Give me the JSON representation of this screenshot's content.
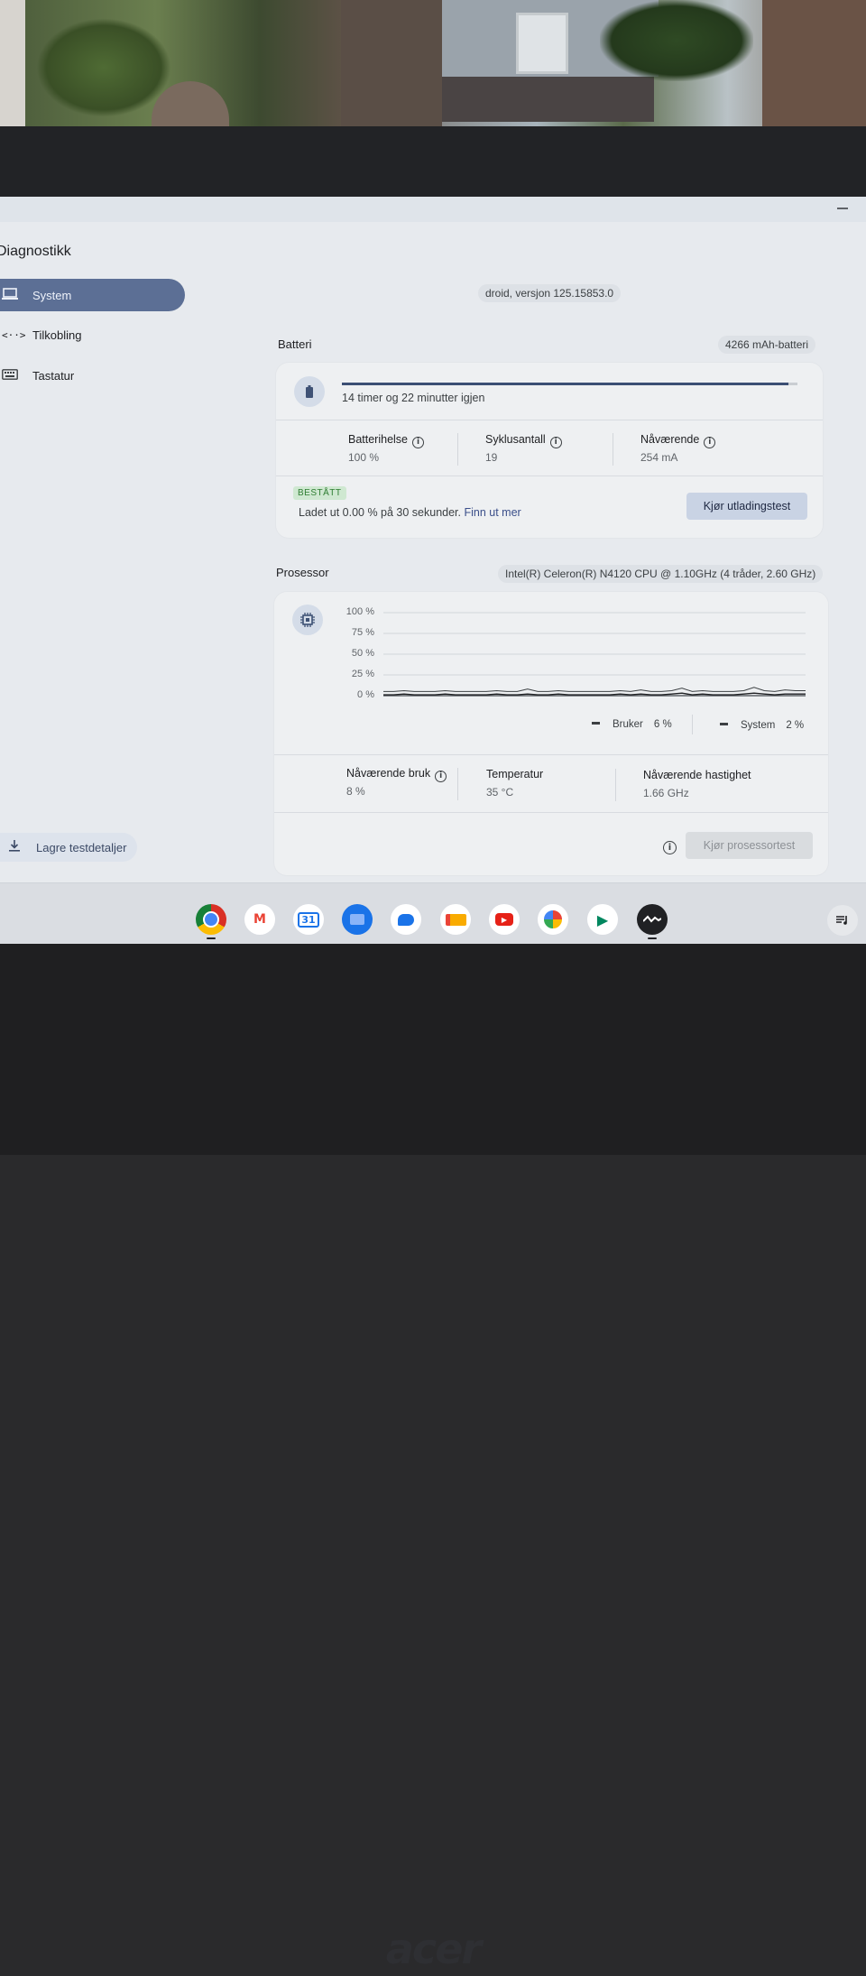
{
  "app": {
    "title": "Diagnostikk",
    "version": "droid, versjon 125.15853.0"
  },
  "sidebar": {
    "items": [
      {
        "label": "System",
        "icon": "laptop-icon",
        "active": true
      },
      {
        "label": "Tilkobling",
        "icon": "connection-icon",
        "active": false
      },
      {
        "label": "Tastatur",
        "icon": "keyboard-icon",
        "active": false
      }
    ],
    "save_label": "Lagre testdetaljer"
  },
  "battery": {
    "section_title": "Batteri",
    "capacity_chip": "4266 mAh-batteri",
    "remaining_text": "14 timer og 22 minutter igjen",
    "charge_level": 0.98,
    "stats": [
      {
        "label": "Batterihelse",
        "value": "100 %"
      },
      {
        "label": "Syklusantall",
        "value": "19"
      },
      {
        "label": "Nåværende",
        "value": "254 mA"
      }
    ],
    "badge": "BESTÅTT",
    "result_text": "Ladet ut 0.00 % på 30 sekunder.",
    "result_link": "Finn ut mer",
    "test_button": "Kjør utladingstest"
  },
  "processor": {
    "section_title": "Prosessor",
    "cpu_chip": "Intel(R) Celeron(R) N4120 CPU @ 1.10GHz (4 tråder, 2.60 GHz)",
    "legend": [
      {
        "name": "Bruker",
        "value": "6 %"
      },
      {
        "name": "System",
        "value": "2 %"
      }
    ],
    "stats": [
      {
        "label": "Nåværende bruk",
        "value": "8 %"
      },
      {
        "label": "Temperatur",
        "value": "35 °C"
      },
      {
        "label": "Nåværende hastighet",
        "value": "1.66 GHz"
      }
    ],
    "test_button": "Kjør prosessortest"
  },
  "chart_data": {
    "type": "line",
    "y_ticks": [
      "100 %",
      "75 %",
      "50 %",
      "25 %",
      "0 %"
    ],
    "ylim": [
      0,
      100
    ],
    "grid": true,
    "legend_position": "bottom-right",
    "series": [
      {
        "name": "Bruker",
        "values": [
          5,
          5,
          6,
          5,
          5,
          5,
          6,
          5,
          5,
          5,
          5,
          6,
          5,
          5,
          8,
          5,
          5,
          6,
          5,
          5,
          5,
          5,
          5,
          6,
          5,
          7,
          5,
          5,
          6,
          9,
          5,
          6,
          5,
          5,
          5,
          6,
          10,
          6,
          5,
          7,
          6,
          6
        ]
      },
      {
        "name": "System",
        "values": [
          1,
          1,
          2,
          1,
          1,
          1,
          2,
          1,
          1,
          1,
          1,
          2,
          1,
          1,
          2,
          1,
          1,
          2,
          1,
          1,
          1,
          1,
          1,
          2,
          1,
          2,
          1,
          1,
          2,
          3,
          1,
          2,
          1,
          1,
          1,
          2,
          3,
          2,
          1,
          2,
          2,
          2
        ]
      }
    ]
  },
  "shelf": {
    "apps": [
      {
        "name": "chrome-icon",
        "glyph": "",
        "color": "#d93025"
      },
      {
        "name": "gmail-icon",
        "glyph": "M",
        "color": "#ea4335"
      },
      {
        "name": "calendar-icon",
        "glyph": "31",
        "color": "#1a73e8"
      },
      {
        "name": "files-icon",
        "glyph": "",
        "color": "#1a73e8"
      },
      {
        "name": "messages-icon",
        "glyph": "",
        "color": "#1a73e8"
      },
      {
        "name": "meet-icon",
        "glyph": "",
        "color": "#f9ab00"
      },
      {
        "name": "youtube-icon",
        "glyph": "▶",
        "color": "#e62117"
      },
      {
        "name": "photos-icon",
        "glyph": "",
        "color": "#fbbc04"
      },
      {
        "name": "play-store-icon",
        "glyph": "▶",
        "color": "#01875f"
      },
      {
        "name": "diagnostics-icon",
        "glyph": "",
        "color": "#202124"
      }
    ]
  },
  "colors": {
    "accent": "#5c6f95",
    "pass": "#2e7d32",
    "chart_line": "#3c4043"
  }
}
